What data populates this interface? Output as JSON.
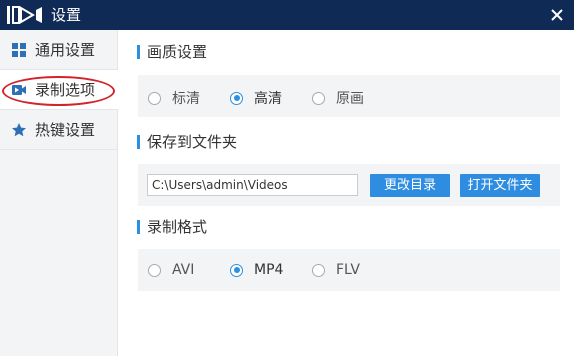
{
  "window": {
    "title": "设置",
    "logo_icon": "video-play-icon",
    "close_icon": "close-icon"
  },
  "sidebar": {
    "items": [
      {
        "label": "通用设置",
        "icon": "grid-icon"
      },
      {
        "label": "录制选项",
        "icon": "video-camera-icon"
      },
      {
        "label": "热键设置",
        "icon": "star-icon"
      }
    ]
  },
  "quality": {
    "title": "画质设置",
    "options": [
      {
        "label": "标清",
        "checked": false
      },
      {
        "label": "高清",
        "checked": true
      },
      {
        "label": "原画",
        "checked": false
      }
    ]
  },
  "save": {
    "title": "保存到文件夹",
    "path_value": "C:\\Users\\admin\\Videos",
    "change_dir_label": "更改目录",
    "open_folder_label": "打开文件夹"
  },
  "format": {
    "title": "录制格式",
    "options": [
      {
        "label": "AVI",
        "checked": false
      },
      {
        "label": "MP4",
        "checked": true
      },
      {
        "label": "FLV",
        "checked": false
      }
    ]
  },
  "colors": {
    "titlebar": "#0f2a55",
    "accent": "#2c8fe0",
    "highlight": "#d2232a"
  }
}
